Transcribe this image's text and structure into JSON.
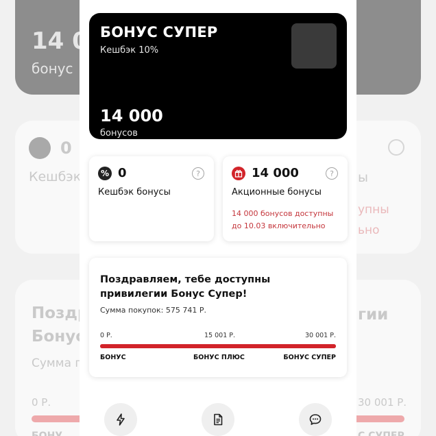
{
  "card": {
    "title": "БОНУС СУПЕР",
    "cashback": "Кешбэк 10%",
    "amount": "14 000",
    "unit": "бонусов"
  },
  "cashback_tile": {
    "value": "0",
    "label": "Кешбэк бонусы",
    "icon": "percent-icon"
  },
  "promo_tile": {
    "value": "14 000",
    "label": "Акционные бонусы",
    "note": "14 000 бонусов доступны до 10.03 включительно",
    "icon": "gift-icon"
  },
  "privileges": {
    "title": "Поздравляем, тебе доступны привилегии Бонус Супер!",
    "sum_text": "Сумма покупок: 575 741 Р.",
    "progress": 1.0,
    "scale": [
      "0 Р.",
      "15 001 Р.",
      "30 001 Р."
    ],
    "levels": [
      "БОНУС",
      "БОНУС ПЛЮС",
      "БОНУС СУПЕР"
    ]
  },
  "actions": [
    "lightning-icon",
    "document-icon",
    "chat-icon"
  ],
  "background_fragments": {
    "amount": "14 0",
    "unit": "бонус",
    "cashback_value": "0",
    "cashback_label": "Кешбэк",
    "promo_label_tail": "ы",
    "promo_note_a": "упны",
    "promo_note_b": "ьно",
    "title_a": "Поздр",
    "title_b": "Бонус",
    "title_tail": "гии",
    "sum": "Сумма п",
    "scale_0": "0 Р.",
    "scale_2": "30 001 Р.",
    "level_0": "БОНУ",
    "level_2": "С СУПЕР"
  },
  "colors": {
    "accent": "#d2242a",
    "card_bg": "#000000"
  }
}
